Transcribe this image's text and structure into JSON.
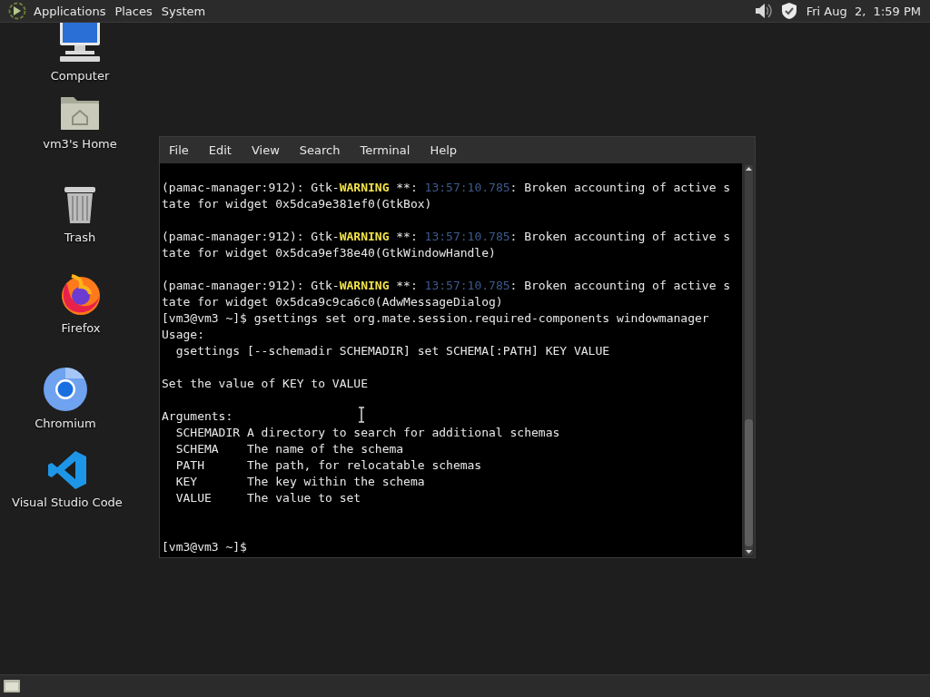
{
  "top_panel": {
    "menus": [
      "Applications",
      "Places",
      "System"
    ],
    "clock": "Fri Aug  2,  1:59 PM"
  },
  "desktop_icons": [
    {
      "kind": "computer",
      "label": "Computer"
    },
    {
      "kind": "home",
      "label": "vm3's Home"
    },
    {
      "kind": "trash",
      "label": "Trash"
    },
    {
      "kind": "firefox",
      "label": "Firefox"
    },
    {
      "kind": "chromium",
      "label": "Chromium"
    },
    {
      "kind": "vscode",
      "label": "Visual Studio Code"
    }
  ],
  "terminal": {
    "menu": [
      "File",
      "Edit",
      "View",
      "Search",
      "Terminal",
      "Help"
    ],
    "lines": [
      {
        "kind": "blank"
      },
      {
        "kind": "text",
        "segments": [
          {
            "kind": "plain",
            "text": "(pamac-manager:912): Gtk-"
          },
          {
            "kind": "warning",
            "text": "WARNING"
          },
          {
            "kind": "plain",
            "text": " **: "
          },
          {
            "kind": "time",
            "text": "13:57:10.785"
          },
          {
            "kind": "plain",
            "text": ": Broken accounting of active s"
          }
        ]
      },
      {
        "kind": "text",
        "segments": [
          {
            "kind": "plain",
            "text": "tate for widget 0x5dca9e381ef0(GtkBox)"
          }
        ]
      },
      {
        "kind": "blank"
      },
      {
        "kind": "text",
        "segments": [
          {
            "kind": "plain",
            "text": "(pamac-manager:912): Gtk-"
          },
          {
            "kind": "warning",
            "text": "WARNING"
          },
          {
            "kind": "plain",
            "text": " **: "
          },
          {
            "kind": "time",
            "text": "13:57:10.785"
          },
          {
            "kind": "plain",
            "text": ": Broken accounting of active s"
          }
        ]
      },
      {
        "kind": "text",
        "segments": [
          {
            "kind": "plain",
            "text": "tate for widget 0x5dca9ef38e40(GtkWindowHandle)"
          }
        ]
      },
      {
        "kind": "blank"
      },
      {
        "kind": "text",
        "segments": [
          {
            "kind": "plain",
            "text": "(pamac-manager:912): Gtk-"
          },
          {
            "kind": "warning",
            "text": "WARNING"
          },
          {
            "kind": "plain",
            "text": " **: "
          },
          {
            "kind": "time",
            "text": "13:57:10.785"
          },
          {
            "kind": "plain",
            "text": ": Broken accounting of active s"
          }
        ]
      },
      {
        "kind": "text",
        "segments": [
          {
            "kind": "plain",
            "text": "tate for widget 0x5dca9c9ca6c0(AdwMessageDialog)"
          }
        ]
      },
      {
        "kind": "text",
        "segments": [
          {
            "kind": "plain",
            "text": "[vm3@vm3 ~]$ gsettings set org.mate.session.required-components windowmanager"
          }
        ]
      },
      {
        "kind": "text",
        "segments": [
          {
            "kind": "plain",
            "text": "Usage:"
          }
        ]
      },
      {
        "kind": "text",
        "segments": [
          {
            "kind": "plain",
            "text": "  gsettings [--schemadir SCHEMADIR] set SCHEMA[:PATH] KEY VALUE"
          }
        ]
      },
      {
        "kind": "blank"
      },
      {
        "kind": "text",
        "segments": [
          {
            "kind": "plain",
            "text": "Set the value of KEY to VALUE"
          }
        ]
      },
      {
        "kind": "blank"
      },
      {
        "kind": "text",
        "segments": [
          {
            "kind": "plain",
            "text": "Arguments:"
          }
        ]
      },
      {
        "kind": "text",
        "segments": [
          {
            "kind": "plain",
            "text": "  SCHEMADIR A directory to search for additional schemas"
          }
        ]
      },
      {
        "kind": "text",
        "segments": [
          {
            "kind": "plain",
            "text": "  SCHEMA    The name of the schema"
          }
        ]
      },
      {
        "kind": "text",
        "segments": [
          {
            "kind": "plain",
            "text": "  PATH      The path, for relocatable schemas"
          }
        ]
      },
      {
        "kind": "text",
        "segments": [
          {
            "kind": "plain",
            "text": "  KEY       The key within the schema"
          }
        ]
      },
      {
        "kind": "text",
        "segments": [
          {
            "kind": "plain",
            "text": "  VALUE     The value to set"
          }
        ]
      },
      {
        "kind": "blank"
      },
      {
        "kind": "blank"
      },
      {
        "kind": "text",
        "segments": [
          {
            "kind": "plain",
            "text": "[vm3@vm3 ~]$ "
          }
        ]
      }
    ]
  }
}
